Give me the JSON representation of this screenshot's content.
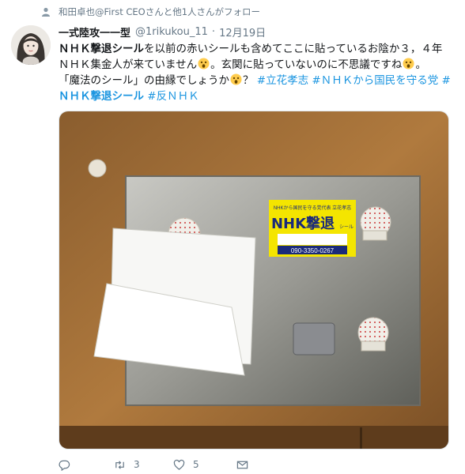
{
  "context": {
    "text": "和田卓也@First CEOさんと他1人さんがフォロー",
    "icon": "person-icon"
  },
  "author": {
    "name": "一式陸攻一一型",
    "handle": "@1rikukou_11",
    "separator": "·",
    "date": "12月19日"
  },
  "tweet": {
    "l1_bold": "ＮＨＫ撃退シール",
    "l1_rest": "を以前の赤いシールも含めてここに貼っているお陰か３，４年",
    "l2_a": "ＮＨＫ集金人が来ていません",
    "l2_b": "。玄関に貼っていないのに不思議ですね",
    "l2_c": "。",
    "l3_a": "「魔法のシール」の由縁でしょうか",
    "l3_b": "？",
    "tag1": "#立花孝志",
    "tag2": "#ＮＨＫから国民を守る党",
    "tag3": "#",
    "l4_tag_bold": "ＮＨＫ撃退シール",
    "tag4": "#反ＮＨＫ",
    "emoji": "astonished-face-emoji"
  },
  "photo": {
    "sticker": {
      "top": "NHKから国民を守る党代表 立花孝志",
      "main": "NHK撃退",
      "side": "シール",
      "phone": "090-3350-0267"
    }
  },
  "actions": {
    "reply": {
      "icon": "reply-icon",
      "count": ""
    },
    "retweet": {
      "icon": "retweet-icon",
      "count": "3"
    },
    "like": {
      "icon": "heart-icon",
      "count": "5"
    },
    "dm": {
      "icon": "envelope-icon",
      "count": ""
    }
  },
  "colors": {
    "link": "#1b95e0",
    "secondary": "#657786",
    "text": "#14171a"
  }
}
